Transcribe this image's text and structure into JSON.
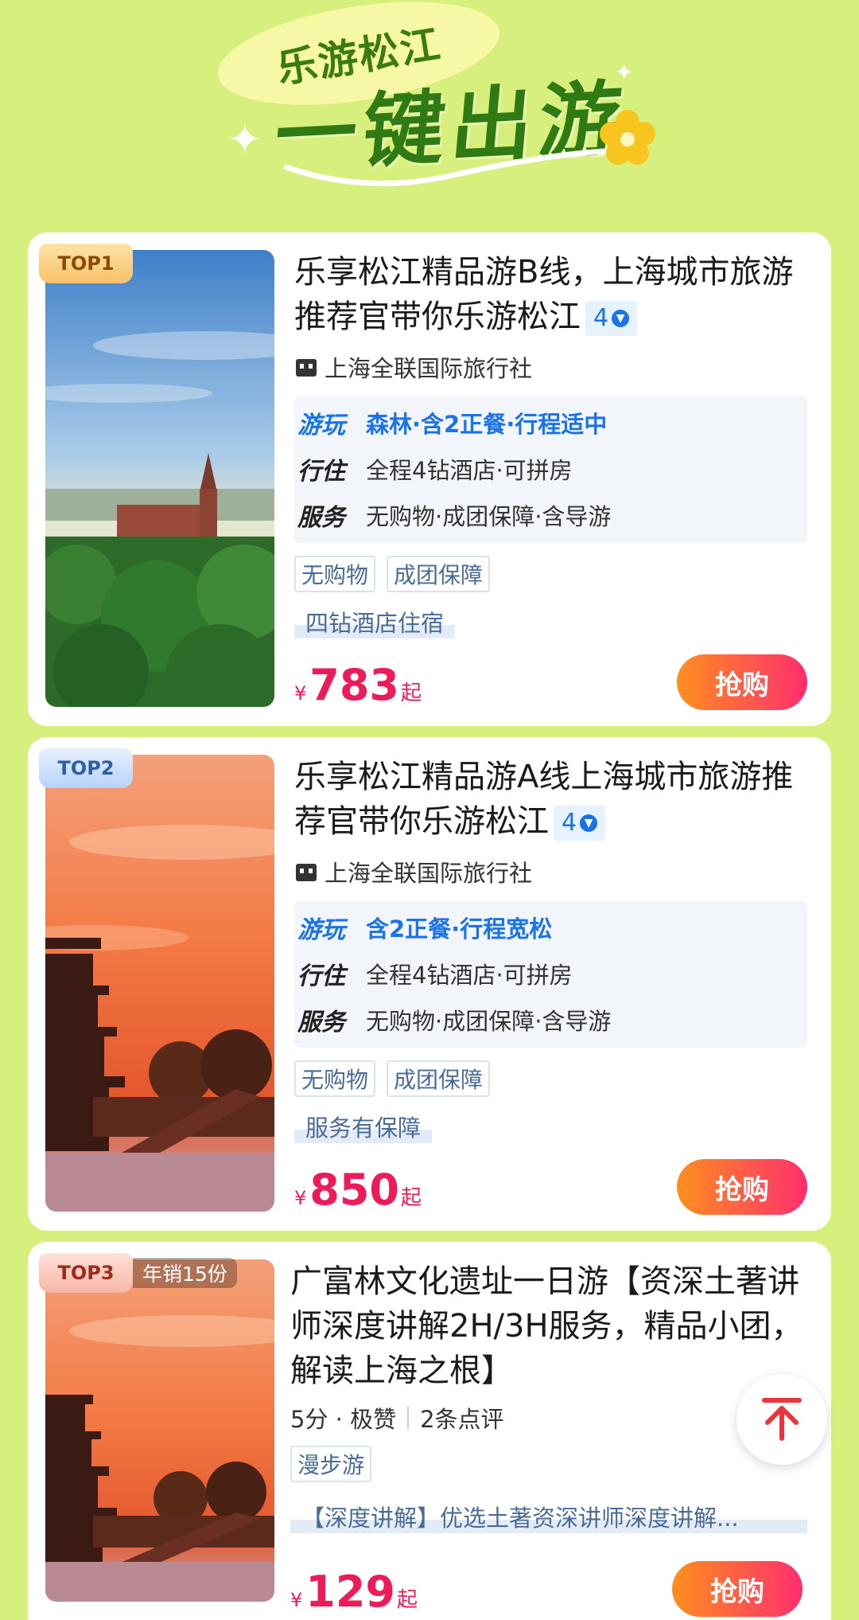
{
  "header": {
    "subtitle": "乐游松江",
    "title": "一键出游"
  },
  "products": [
    {
      "rank_label": "TOP1",
      "title": "乐享松江精品游B线，上海城市旅游推荐官带你乐游松江",
      "score": "4",
      "agency": "上海全联国际旅行社",
      "features": [
        {
          "key": "游玩",
          "value": "森林·含2正餐·行程适中"
        },
        {
          "key": "行住",
          "value": "全程4钻酒店·可拼房"
        },
        {
          "key": "服务",
          "value": "无购物·成团保障·含导游"
        }
      ],
      "tags": [
        "无购物",
        "成团保障"
      ],
      "highlight": "四钻酒店住宿",
      "price_currency": "¥",
      "price": "783",
      "price_suffix": "起",
      "buy_label": "抢购"
    },
    {
      "rank_label": "TOP2",
      "title": "乐享松江精品游A线上海城市旅游推荐官带你乐游松江",
      "score": "4",
      "agency": "上海全联国际旅行社",
      "features": [
        {
          "key": "游玩",
          "value": "含2正餐·行程宽松"
        },
        {
          "key": "行住",
          "value": "全程4钻酒店·可拼房"
        },
        {
          "key": "服务",
          "value": "无购物·成团保障·含导游"
        }
      ],
      "tags": [
        "无购物",
        "成团保障"
      ],
      "highlight": "服务有保障",
      "price_currency": "¥",
      "price": "850",
      "price_suffix": "起",
      "buy_label": "抢购"
    },
    {
      "rank_label": "TOP3",
      "sales": "年销15份",
      "title": "广富林文化遗址一日游【资深土著讲师深度讲解2H/3H服务，精品小团，解读上海之根】",
      "rating_text": "5分 · 极赞",
      "reviews": "2条点评",
      "tags": [
        "漫步游"
      ],
      "highlight": "【深度讲解】优选土著资深讲师深度讲解...",
      "price_currency": "¥",
      "price": "129",
      "price_suffix": "起",
      "buy_label": "抢购"
    }
  ],
  "colors": {
    "background": "#d7ef7c",
    "price": "#ee1b5a",
    "accent_blue": "#1a73e8",
    "button_from": "#ff8f1f",
    "button_to": "#ff2e6d"
  }
}
